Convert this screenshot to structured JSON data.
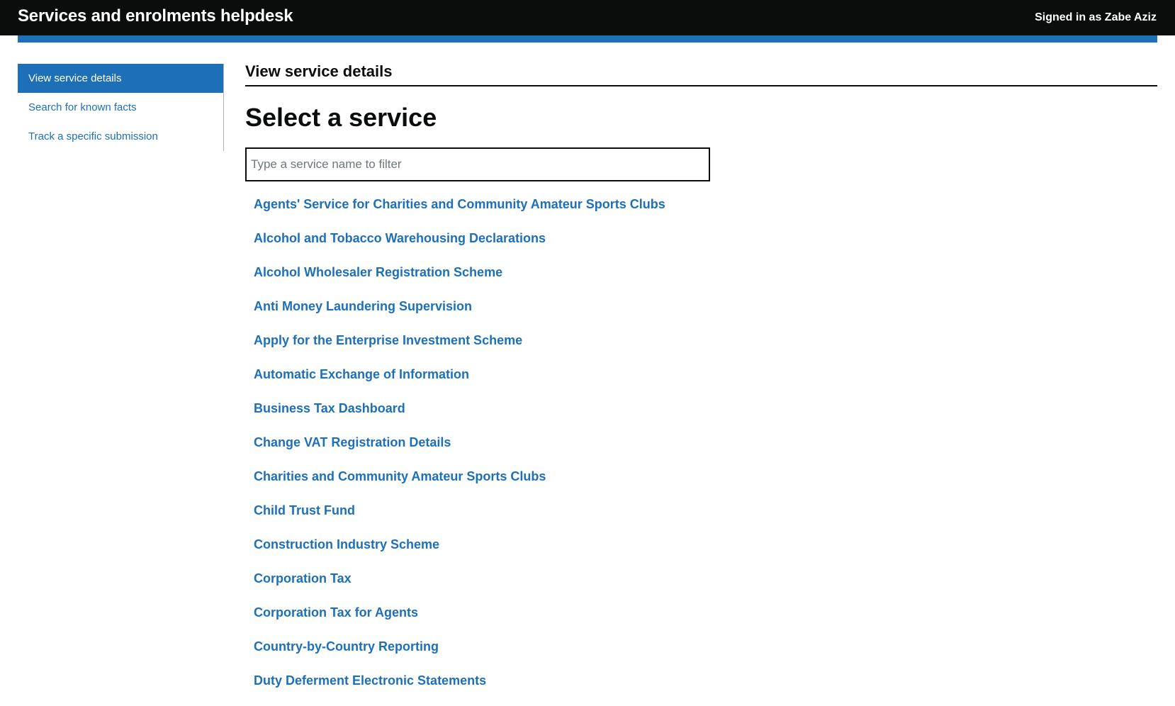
{
  "header": {
    "title": "Services and enrolments helpdesk",
    "user": "Signed in as Zabe Aziz"
  },
  "sidebar": {
    "items": [
      {
        "label": "View service details",
        "active": true
      },
      {
        "label": "Search for known facts",
        "active": false
      },
      {
        "label": "Track a specific submission",
        "active": false
      }
    ]
  },
  "main": {
    "caption": "View service details",
    "heading": "Select a service",
    "filter_placeholder": "Type a service name to filter",
    "filter_value": "",
    "services": [
      "Agents' Service for Charities and Community Amateur Sports Clubs",
      "Alcohol and Tobacco Warehousing Declarations",
      "Alcohol Wholesaler Registration Scheme",
      "Anti Money Laundering Supervision",
      "Apply for the Enterprise Investment Scheme",
      "Automatic Exchange of Information",
      "Business Tax Dashboard",
      "Change VAT Registration Details",
      "Charities and Community Amateur Sports Clubs",
      "Child Trust Fund",
      "Construction Industry Scheme",
      "Corporation Tax",
      "Corporation Tax for Agents",
      "Country-by-Country Reporting",
      "Duty Deferment Electronic Statements"
    ]
  },
  "colors": {
    "header_bg": "#0b0c0c",
    "accent_blue": "#1d70b8",
    "text": "#0b0c0c",
    "sidebar_border": "#b1b4b6"
  }
}
